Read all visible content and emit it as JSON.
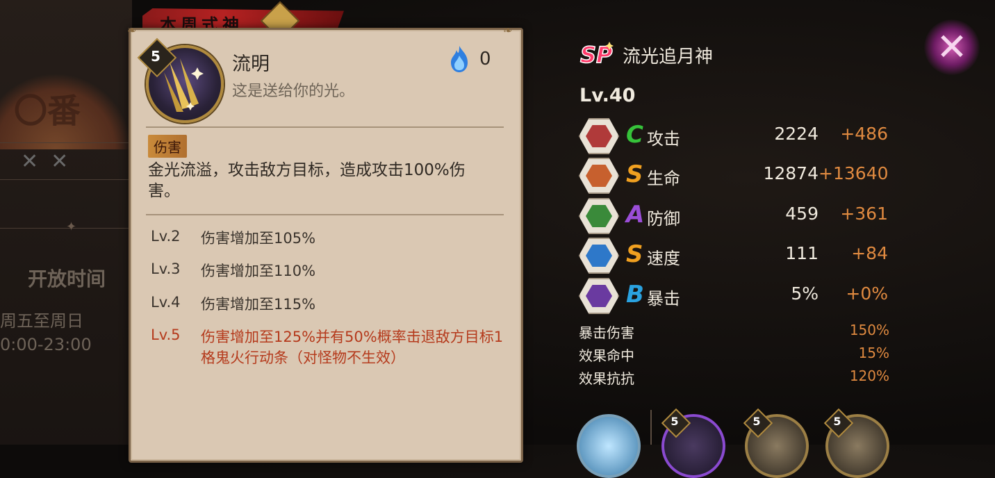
{
  "background": {
    "banner_text": "〇番",
    "open_time_title": "开放时间",
    "open_days": "周五至周日",
    "open_hours": "0:00-23:00"
  },
  "tab": {
    "title": "本周式神"
  },
  "skill": {
    "level": "5",
    "name": "流明",
    "quote": "这是送给你的光。",
    "fire_cost": "0",
    "tag": "伤害",
    "description": "金光流溢，攻击敌方目标，造成攻击100%伤害。",
    "upgrades": [
      {
        "level": "Lv.2",
        "text": "伤害增加至105%"
      },
      {
        "level": "Lv.3",
        "text": "伤害增加至110%"
      },
      {
        "level": "Lv.4",
        "text": "伤害增加至115%"
      },
      {
        "level": "Lv.5",
        "text": "伤害增加至125%并有50%概率击退敌方目标1格鬼火行动条（对怪物不生效）"
      }
    ]
  },
  "shikigami": {
    "rarity": "SP",
    "name": "流光追月神",
    "level": "Lv.40"
  },
  "stats": [
    {
      "grade": "C",
      "grade_color": "#36c23a",
      "name": "攻击",
      "base": "2224",
      "bonus": "+486",
      "icon": "fan-icon",
      "icon_color": "#b03a3a"
    },
    {
      "grade": "S",
      "grade_color": "#f0a020",
      "name": "生命",
      "base": "12874",
      "bonus": "+13640",
      "icon": "scroll-icon",
      "icon_color": "#c7602e"
    },
    {
      "grade": "A",
      "grade_color": "#9b4ed8",
      "name": "防御",
      "base": "459",
      "bonus": "+361",
      "icon": "armor-icon",
      "icon_color": "#3a8a3a"
    },
    {
      "grade": "S",
      "grade_color": "#f0a020",
      "name": "速度",
      "base": "111",
      "bonus": "+84",
      "icon": "arrow-icon",
      "icon_color": "#2e78c9"
    },
    {
      "grade": "B",
      "grade_color": "#2aa2e0",
      "name": "暴击",
      "base": "5%",
      "bonus": "+0%",
      "icon": "talisman-icon",
      "icon_color": "#6a3aa0"
    }
  ],
  "extra_stats": [
    {
      "name": "暴击伤害",
      "value": "150%"
    },
    {
      "name": "效果命中",
      "value": "15%"
    },
    {
      "name": "效果抗抗",
      "value": "120%"
    }
  ],
  "portraits": [
    {
      "badge": ""
    },
    {
      "badge": "5"
    },
    {
      "badge": "5"
    },
    {
      "badge": "5"
    }
  ]
}
